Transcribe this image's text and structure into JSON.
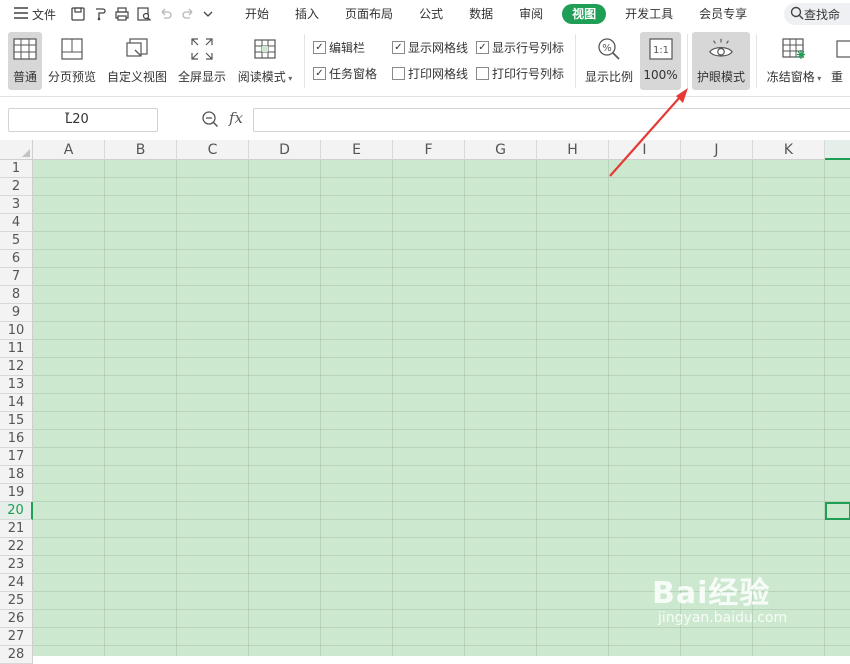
{
  "menubar": {
    "file_label": "文件",
    "tabs": [
      {
        "label": "开始",
        "active": false
      },
      {
        "label": "插入",
        "active": false
      },
      {
        "label": "页面布局",
        "active": false
      },
      {
        "label": "公式",
        "active": false
      },
      {
        "label": "数据",
        "active": false
      },
      {
        "label": "审阅",
        "active": false
      },
      {
        "label": "视图",
        "active": true
      },
      {
        "label": "开发工具",
        "active": false
      },
      {
        "label": "会员专享",
        "active": false
      }
    ],
    "search_label": "查找命",
    "active_tab_color": "#1f9e55"
  },
  "ribbon": {
    "normal": "普通",
    "page_break_preview": "分页预览",
    "custom_view": "自定义视图",
    "full_screen": "全屏显示",
    "reading_mode": "阅读模式",
    "checkboxes": {
      "edit_bar": {
        "label": "编辑栏",
        "checked": true
      },
      "task_pane": {
        "label": "任务窗格",
        "checked": true
      },
      "show_gridlines": {
        "label": "显示网格线",
        "checked": true
      },
      "print_gridlines": {
        "label": "打印网格线",
        "checked": false
      },
      "show_headings": {
        "label": "显示行号列标",
        "checked": true
      },
      "print_headings": {
        "label": "打印行号列标",
        "checked": false
      }
    },
    "zoom": "显示比例",
    "zoom_100_icon": "1:1",
    "zoom_100": "100%",
    "eye_protection": "护眼模式",
    "freeze_panes": "冻结窗格",
    "rearrange": "重"
  },
  "formula_bar": {
    "name_box": "L20",
    "fx_label": "fx",
    "formula": ""
  },
  "sheet": {
    "columns": [
      "A",
      "B",
      "C",
      "D",
      "E",
      "F",
      "G",
      "H",
      "I",
      "J",
      "K",
      ""
    ],
    "rows": [
      "1",
      "2",
      "3",
      "4",
      "5",
      "6",
      "7",
      "8",
      "9",
      "10",
      "11",
      "12",
      "13",
      "14",
      "15",
      "16",
      "17",
      "18",
      "19",
      "20",
      "21",
      "22",
      "23",
      "24",
      "25",
      "26",
      "27",
      "28"
    ],
    "active_row": "20",
    "active_cell": "L20",
    "grid_color": "#cce8cf"
  },
  "watermark": {
    "brand": "Bai经验",
    "url": "jingyan.baidu.com"
  },
  "annotation": {
    "arrow_color": "#e53935"
  }
}
